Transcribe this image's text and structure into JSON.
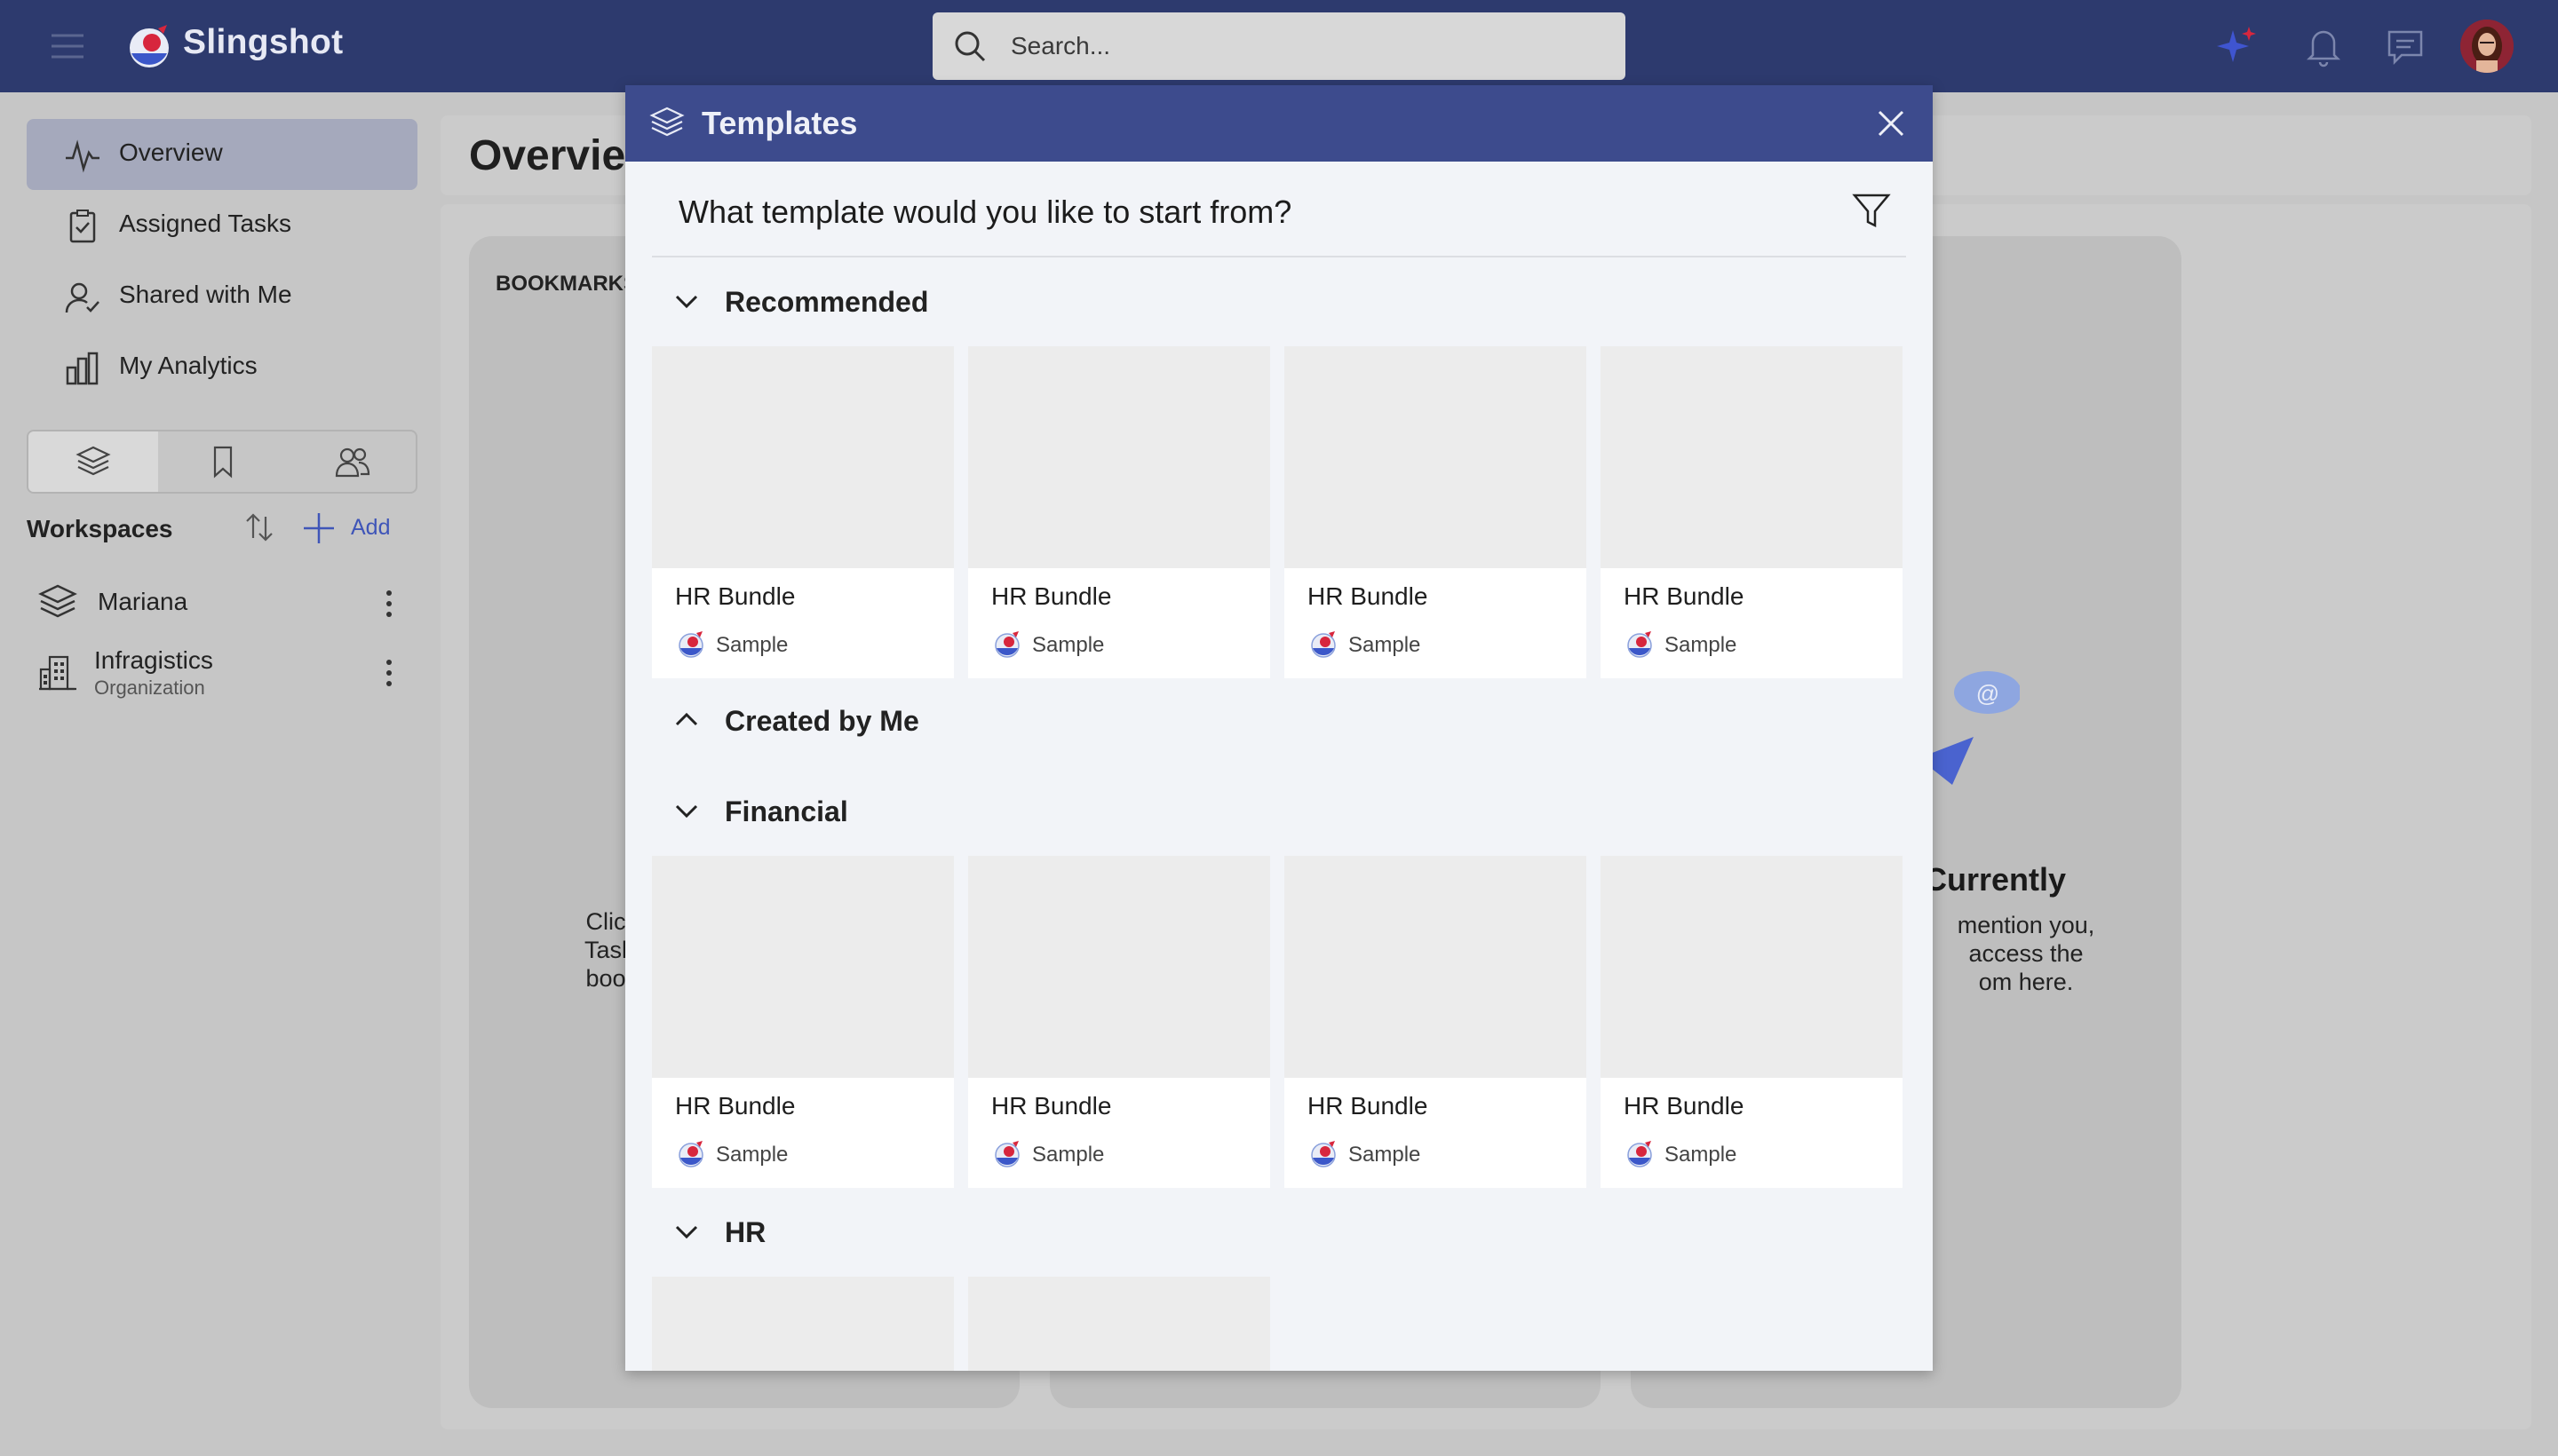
{
  "app": {
    "name": "Slingshot"
  },
  "search": {
    "placeholder": "Search..."
  },
  "sidebar": {
    "items": [
      {
        "label": "Overview"
      },
      {
        "label": "Assigned Tasks"
      },
      {
        "label": "Shared with Me"
      },
      {
        "label": "My Analytics"
      }
    ],
    "workspaces_title": "Workspaces",
    "add_label": "Add",
    "workspaces": [
      {
        "name": "Mariana"
      },
      {
        "name": "Infragistics",
        "subtitle": "Organization"
      }
    ]
  },
  "page": {
    "title": "Overview",
    "bookmarks_title": "BOOKMARKS",
    "bookmarks_text": [
      "Clic",
      "Tasl",
      "boo"
    ],
    "mentions_title": "Currently",
    "mentions_text": [
      "mention you,",
      "access the",
      "om here."
    ]
  },
  "modal": {
    "title": "Templates",
    "question": "What template would you like to start from?",
    "sections": [
      {
        "label": "Recommended",
        "expanded": true,
        "templates": [
          {
            "title": "HR Bundle",
            "subtitle": "Sample"
          },
          {
            "title": "HR Bundle",
            "subtitle": "Sample"
          },
          {
            "title": "HR Bundle",
            "subtitle": "Sample"
          },
          {
            "title": "HR Bundle",
            "subtitle": "Sample"
          }
        ]
      },
      {
        "label": "Created by Me",
        "expanded": false,
        "templates": []
      },
      {
        "label": "Financial",
        "expanded": true,
        "templates": [
          {
            "title": "HR Bundle",
            "subtitle": "Sample"
          },
          {
            "title": "HR Bundle",
            "subtitle": "Sample"
          },
          {
            "title": "HR Bundle",
            "subtitle": "Sample"
          },
          {
            "title": "HR Bundle",
            "subtitle": "Sample"
          }
        ]
      },
      {
        "label": "HR",
        "expanded": true,
        "templates": []
      }
    ]
  },
  "colors": {
    "topbar": "#2d3a6e",
    "modal_header": "#3d4b8d",
    "accent": "#3f55b8"
  }
}
